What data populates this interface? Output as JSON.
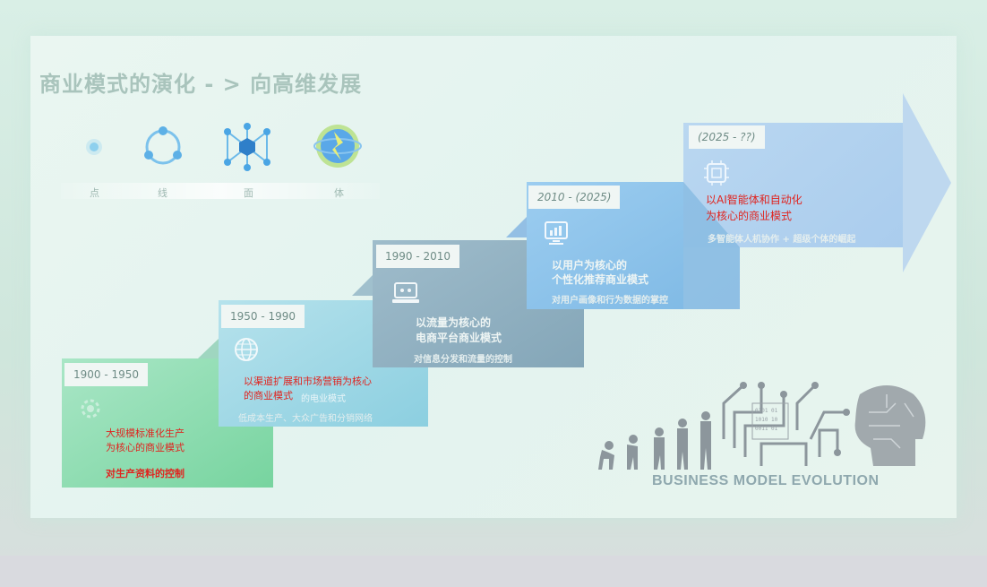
{
  "title": "商业模式的演化 - > 向高维发展",
  "evolution": [
    {
      "icon": "dot-icon",
      "label": "点"
    },
    {
      "icon": "circle-line-icon",
      "label": "线"
    },
    {
      "icon": "network-icon",
      "label": "面"
    },
    {
      "icon": "globe-icon",
      "label": "体"
    }
  ],
  "steps": [
    {
      "years": "1900 - 1950",
      "icon": "gear-icon",
      "red_line1": "大规模标准化生产",
      "red_line2": "为核心的商业模式",
      "red_bold": "对生产资料的控制"
    },
    {
      "years": "1950 - 1990",
      "icon": "globe-grid-icon",
      "red_line1": "以渠道扩展和市场营销为核心",
      "red_line2": "的商业模式",
      "faded_suffix": "的电业模式",
      "sub": "低成本生产、大众广告和分销网络"
    },
    {
      "years": "1990 - 2010",
      "icon": "laptop-icon",
      "line1": "以流量为核心的",
      "line2": "电商平台商业模式",
      "sub": "对信息分发和流量的控制"
    },
    {
      "years": "2010 - (2025)",
      "icon": "monitor-chart-icon",
      "line1": "以用户为核心的",
      "line2": "个性化推荐商业模式",
      "sub": "对用户画像和行为数据的掌控"
    },
    {
      "years": "(2025 - ??)",
      "icon": "ai-chip-icon",
      "red_line1": "以AI智能体和自动化",
      "red_line2": "为核心的商业模式",
      "sub": "多智能体人机协作 + 超级个体的崛起"
    }
  ],
  "footer": "BUSINESS MODEL EVOLUTION",
  "colors": {
    "step1": "#8fdcb2",
    "step2": "#9fd6e4",
    "step3": "#90aebe",
    "step4": "#8ec3e6",
    "step5": "#a9ccea",
    "arrow": "#bcd6ee",
    "red": "#e0241f"
  }
}
